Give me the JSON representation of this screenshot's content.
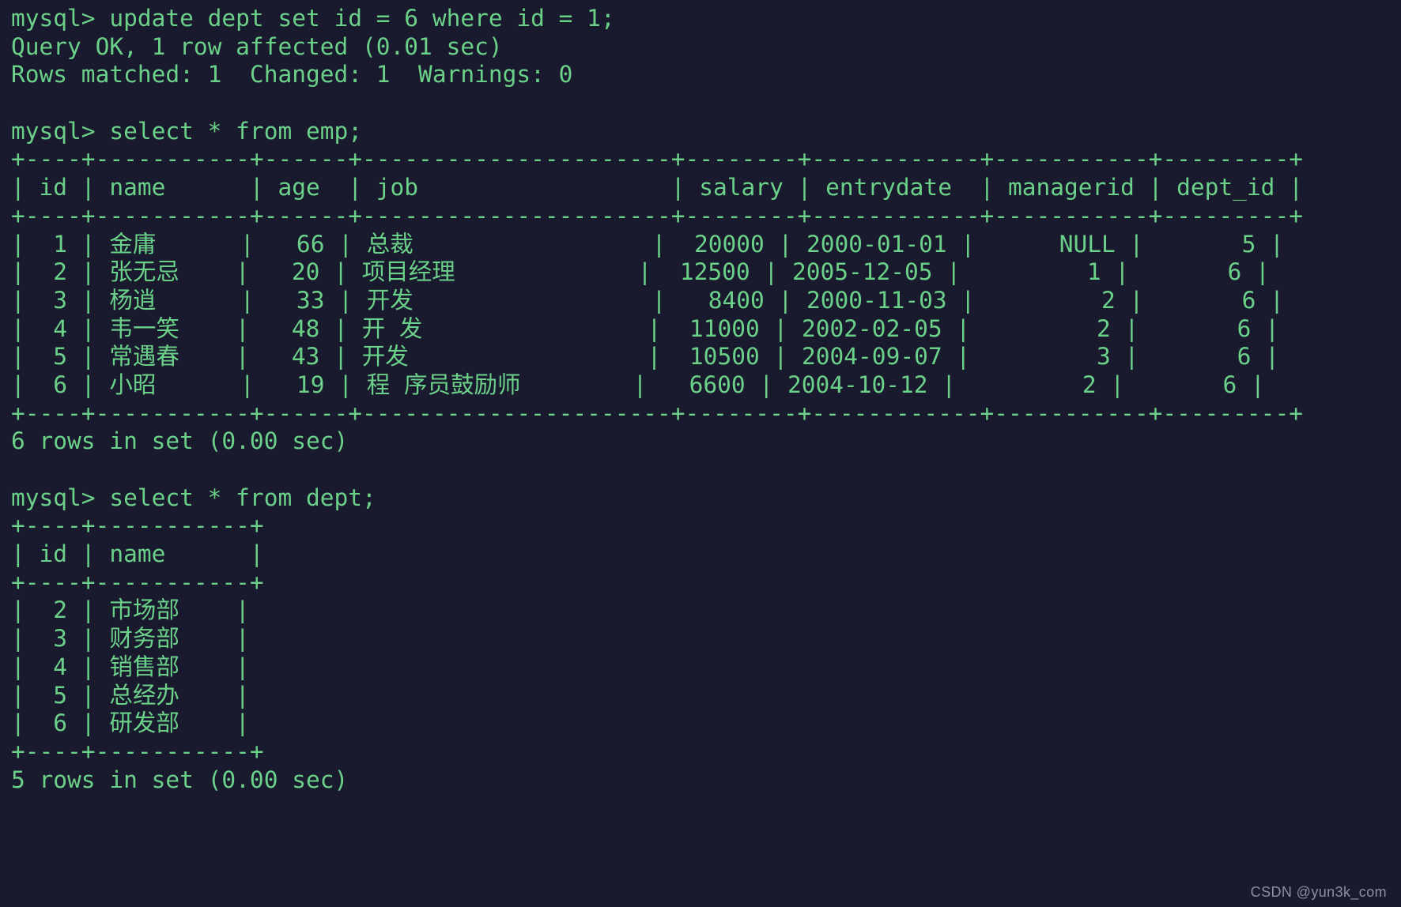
{
  "terminal": {
    "prompt": "mysql> ",
    "colors": {
      "background": "#191a2e",
      "foreground": "#6bd189",
      "watermark": "#8b8fa3"
    },
    "lines": [
      "mysql> update dept set id = 6 where id = 1;",
      "Query OK, 1 row affected (0.01 sec)",
      "Rows matched: 1  Changed: 1  Warnings: 0",
      "",
      "mysql> select * from emp;",
      "+----+-----------+------+----------------------+--------+------------+-----------+---------+",
      "| id | name      | age  | job                  | salary | entrydate  | managerid | dept_id |",
      "+----+-----------+------+----------------------+--------+------------+-----------+---------+",
      "|  1 | 金庸      |   66 | 总裁                 |  20000 | 2000-01-01 |      NULL |       5 |",
      "|  2 | 张无忌    |   20 | 项目经理             |  12500 | 2005-12-05 |         1 |       6 |",
      "|  3 | 杨逍      |   33 | 开发                 |   8400 | 2000-11-03 |         2 |       6 |",
      "|  4 | 韦一笑    |   48 | 开 发                |  11000 | 2002-02-05 |         2 |       6 |",
      "|  5 | 常遇春    |   43 | 开发                 |  10500 | 2004-09-07 |         3 |       6 |",
      "|  6 | 小昭      |   19 | 程 序员鼓励师        |   6600 | 2004-10-12 |         2 |       6 |",
      "+----+-----------+------+----------------------+--------+------------+-----------+---------+",
      "6 rows in set (0.00 sec)",
      "",
      "mysql> select * from dept;",
      "+----+-----------+",
      "| id | name      |",
      "+----+-----------+",
      "|  2 | 市场部    |",
      "|  3 | 财务部    |",
      "|  4 | 销售部    |",
      "|  5 | 总经办    |",
      "|  6 | 研发部    |",
      "+----+-----------+",
      "5 rows in set (0.00 sec)"
    ],
    "commands": [
      "update dept set id = 6 where id = 1;",
      "select * from emp;",
      "select * from dept;"
    ],
    "statuses": [
      "Query OK, 1 row affected (0.01 sec)",
      "Rows matched: 1  Changed: 1  Warnings: 0",
      "6 rows in set (0.00 sec)",
      "5 rows in set (0.00 sec)"
    ],
    "result_tables": [
      {
        "name": "emp",
        "columns": [
          "id",
          "name",
          "age",
          "job",
          "salary",
          "entrydate",
          "managerid",
          "dept_id"
        ],
        "rows": [
          [
            "1",
            "金庸",
            "66",
            "总裁",
            "20000",
            "2000-01-01",
            "NULL",
            "5"
          ],
          [
            "2",
            "张无忌",
            "20",
            "项目经理",
            "12500",
            "2005-12-05",
            "1",
            "6"
          ],
          [
            "3",
            "杨逍",
            "33",
            "开发",
            "8400",
            "2000-11-03",
            "2",
            "6"
          ],
          [
            "4",
            "韦一笑",
            "48",
            "开 发",
            "11000",
            "2002-02-05",
            "2",
            "6"
          ],
          [
            "5",
            "常遇春",
            "43",
            "开发",
            "10500",
            "2004-09-07",
            "3",
            "6"
          ],
          [
            "6",
            "小昭",
            "19",
            "程 序员鼓励师",
            "6600",
            "2004-10-12",
            "2",
            "6"
          ]
        ],
        "row_count_text": "6 rows in set (0.00 sec)"
      },
      {
        "name": "dept",
        "columns": [
          "id",
          "name"
        ],
        "rows": [
          [
            "2",
            "市场部"
          ],
          [
            "3",
            "财务部"
          ],
          [
            "4",
            "销售部"
          ],
          [
            "5",
            "总经办"
          ],
          [
            "6",
            "研发部"
          ]
        ],
        "row_count_text": "5 rows in set (0.00 sec)"
      }
    ]
  },
  "watermark": {
    "text": "CSDN @yun3k_com"
  }
}
